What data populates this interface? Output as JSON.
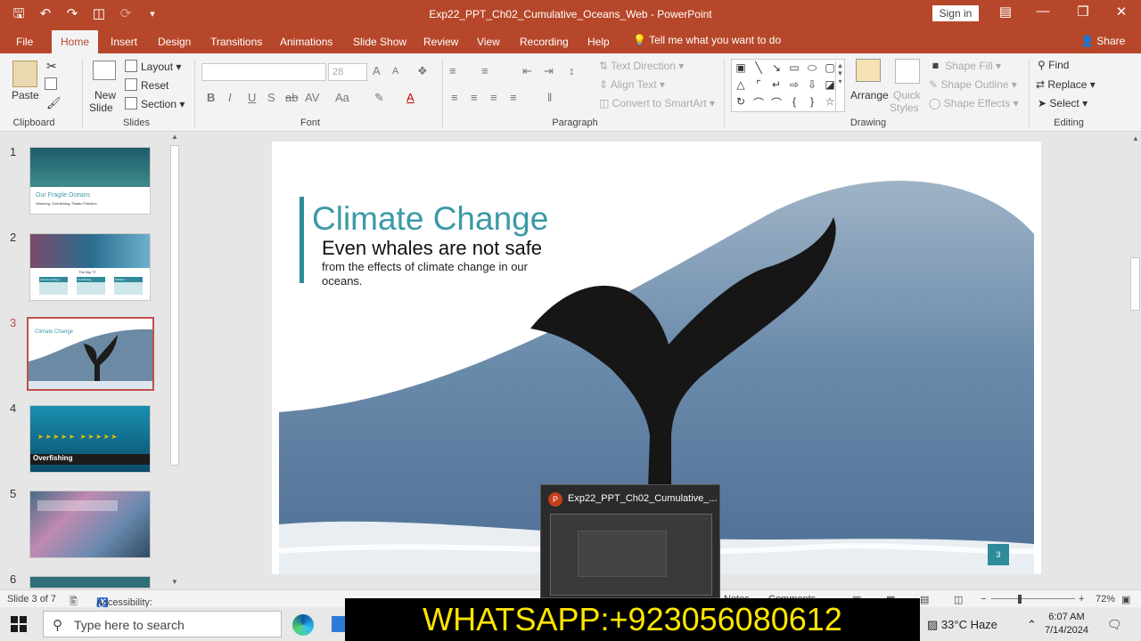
{
  "app": {
    "title": "Exp22_PPT_Ch02_Cumulative_Oceans_Web  -  PowerPoint",
    "sign_in": "Sign in",
    "share": "Share",
    "tell_me": "Tell me what you want to do",
    "accent_color": "#b7472a"
  },
  "tabs": [
    "File",
    "Home",
    "Insert",
    "Design",
    "Transitions",
    "Animations",
    "Slide Show",
    "Review",
    "View",
    "Recording",
    "Help"
  ],
  "ribbon": {
    "clipboard": {
      "label": "Clipboard",
      "paste": "Paste"
    },
    "slides": {
      "label": "Slides",
      "new_slide_1": "New",
      "new_slide_2": "Slide",
      "layout": "Layout",
      "reset": "Reset",
      "section": "Section"
    },
    "font": {
      "label": "Font",
      "size": "28",
      "bold": "B",
      "italic": "I",
      "underline": "U",
      "strike": "S",
      "grow": "A",
      "shrink": "A",
      "case": "Aa",
      "spacing": "AV"
    },
    "paragraph": {
      "label": "Paragraph",
      "text_direction": "Text Direction",
      "align_text": "Align Text",
      "smartart": "Convert to SmartArt"
    },
    "drawing": {
      "label": "Drawing",
      "arrange": "Arrange",
      "quick_styles_1": "Quick",
      "quick_styles_2": "Styles",
      "shape_fill": "Shape Fill",
      "shape_outline": "Shape Outline",
      "shape_effects": "Shape Effects"
    },
    "editing": {
      "label": "Editing",
      "find": "Find",
      "replace": "Replace",
      "select": "Select"
    }
  },
  "thumbnails": [
    {
      "num": "1",
      "caption": "Our Fragile Oceans",
      "sub": "Warming, Overfishing, Plastic Pollution"
    },
    {
      "num": "2",
      "caption": "The Big \"3\"",
      "cols": [
        "Climate Change",
        "Overfishing",
        "Pollution"
      ]
    },
    {
      "num": "3",
      "caption": "Climate Change",
      "selected": true
    },
    {
      "num": "4",
      "caption": "Overfishing"
    },
    {
      "num": "5",
      "caption": ""
    },
    {
      "num": "6",
      "caption": ""
    }
  ],
  "slide": {
    "title": "Climate Change",
    "subtitle": "Even whales are not safe",
    "body": "from the effects of climate change in our oceans.",
    "number": "3"
  },
  "status": {
    "slide_info": "Slide 3 of 7",
    "accessibility": "Accessibility: Investigate",
    "notes": "Notes",
    "comments": "Comments",
    "zoom": "72%"
  },
  "taskbar": {
    "search_placeholder": "Type here to search",
    "weather": "33°C  Haze",
    "time": "6:07 AM",
    "date": "7/14/2024"
  },
  "preview": {
    "title": "Exp22_PPT_Ch02_Cumulative_..."
  },
  "watermark": "WHATSAPP:+923056080612"
}
